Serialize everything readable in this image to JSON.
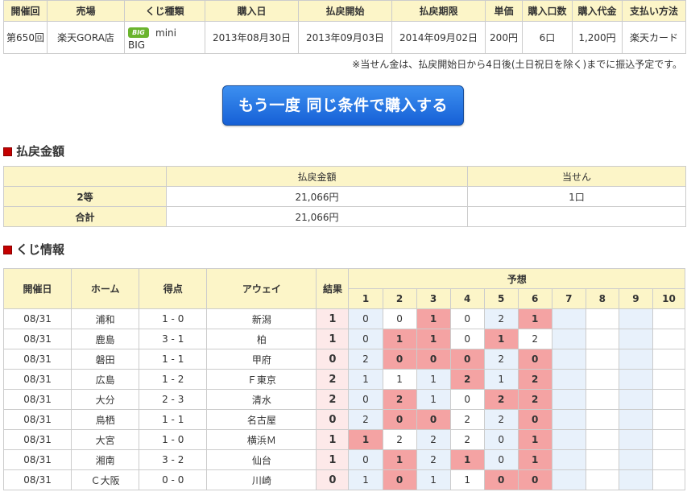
{
  "purchase": {
    "headers": [
      "開催回",
      "売場",
      "くじ種類",
      "購入日",
      "払戻開始",
      "払戻期限",
      "単価",
      "購入口数",
      "購入代金",
      "支払い方法"
    ],
    "row": {
      "kaisai": "第650回",
      "uriba": "楽天GORA店",
      "kuji_logo": "BIG",
      "kuji_name_1": "mini",
      "kuji_name_2": "BIG",
      "purchase_date": "2013年08月30日",
      "payout_start": "2013年09月03日",
      "payout_deadline": "2014年09月02日",
      "unit_price": "200円",
      "units": "6口",
      "total": "1,200円",
      "payment": "楽天カード"
    }
  },
  "note": "※当せん金は、払戻開始日から4日後(土日祝日を除く)までに振込予定です。",
  "rebuy_button": "もう一度 同じ条件で購入する",
  "payout_section": {
    "title": "払戻金額",
    "headers": [
      "払戻金額",
      "当せん"
    ],
    "rows": [
      {
        "label": "2等",
        "amount": "21,066円",
        "count": "1口"
      },
      {
        "label": "合計",
        "amount": "21,066円",
        "count": ""
      }
    ]
  },
  "kuji_section": {
    "title": "くじ情報",
    "headers": {
      "date": "開催日",
      "home": "ホーム",
      "score": "得点",
      "away": "アウェイ",
      "result": "結果",
      "yosou": "予想"
    },
    "yosou_cols": [
      "1",
      "2",
      "3",
      "4",
      "5",
      "6",
      "7",
      "8",
      "9",
      "10"
    ],
    "matches": [
      {
        "date": "08/31",
        "home": "浦和",
        "score": "1 - 0",
        "away": "新潟",
        "result": "1",
        "picks": [
          "0",
          "0",
          "1",
          "0",
          "2",
          "1"
        ]
      },
      {
        "date": "08/31",
        "home": "鹿島",
        "score": "3 - 1",
        "away": "柏",
        "result": "1",
        "picks": [
          "0",
          "1",
          "1",
          "0",
          "1",
          "2"
        ]
      },
      {
        "date": "08/31",
        "home": "磐田",
        "score": "1 - 1",
        "away": "甲府",
        "result": "0",
        "picks": [
          "2",
          "0",
          "0",
          "0",
          "2",
          "0"
        ]
      },
      {
        "date": "08/31",
        "home": "広島",
        "score": "1 - 2",
        "away": "Ｆ東京",
        "result": "2",
        "picks": [
          "1",
          "1",
          "1",
          "2",
          "1",
          "2"
        ]
      },
      {
        "date": "08/31",
        "home": "大分",
        "score": "2 - 3",
        "away": "清水",
        "result": "2",
        "picks": [
          "0",
          "2",
          "1",
          "0",
          "2",
          "2"
        ]
      },
      {
        "date": "08/31",
        "home": "鳥栖",
        "score": "1 - 1",
        "away": "名古屋",
        "result": "0",
        "picks": [
          "2",
          "0",
          "0",
          "2",
          "2",
          "0"
        ]
      },
      {
        "date": "08/31",
        "home": "大宮",
        "score": "1 - 0",
        "away": "横浜Ｍ",
        "result": "1",
        "picks": [
          "1",
          "2",
          "2",
          "2",
          "0",
          "1"
        ]
      },
      {
        "date": "08/31",
        "home": "湘南",
        "score": "3 - 2",
        "away": "仙台",
        "result": "1",
        "picks": [
          "0",
          "1",
          "2",
          "1",
          "0",
          "1"
        ]
      },
      {
        "date": "08/31",
        "home": "Ｃ大阪",
        "score": "0 - 0",
        "away": "川崎",
        "result": "0",
        "picks": [
          "1",
          "0",
          "1",
          "1",
          "0",
          "0"
        ]
      }
    ]
  },
  "colors": {
    "header_bg": "#fcf5c8",
    "hit_bg": "#f4a3a3",
    "result_bg": "#fde9e9",
    "even_col_bg": "#e8f1fb",
    "button_blue": "#1660d6",
    "section_mark": "#c40000"
  }
}
